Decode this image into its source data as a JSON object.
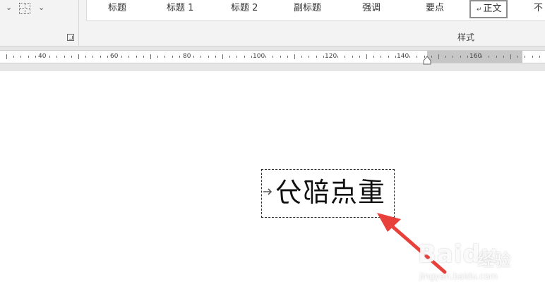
{
  "ribbon": {
    "paragraph_group": {
      "icons": [
        "dropdown-chevron-icon",
        "borders-icon",
        "dialog-launcher-icon"
      ]
    },
    "styles": {
      "items": [
        "标题",
        "标题 1",
        "标题 2",
        "副标题",
        "强调",
        "要点",
        "正文",
        "不"
      ],
      "selected": "正文",
      "group_label": "样式"
    }
  },
  "ruler": {
    "labels": [
      "40",
      "60",
      "80",
      "100",
      "120",
      "140",
      "160"
    ]
  },
  "document": {
    "textbox_text": "重点部分"
  },
  "annotation": {
    "arrow_color": "#e8403a"
  },
  "watermark": {
    "brand": "Baidu",
    "suffix": "经验",
    "url": "jingyan.baidu.com"
  }
}
